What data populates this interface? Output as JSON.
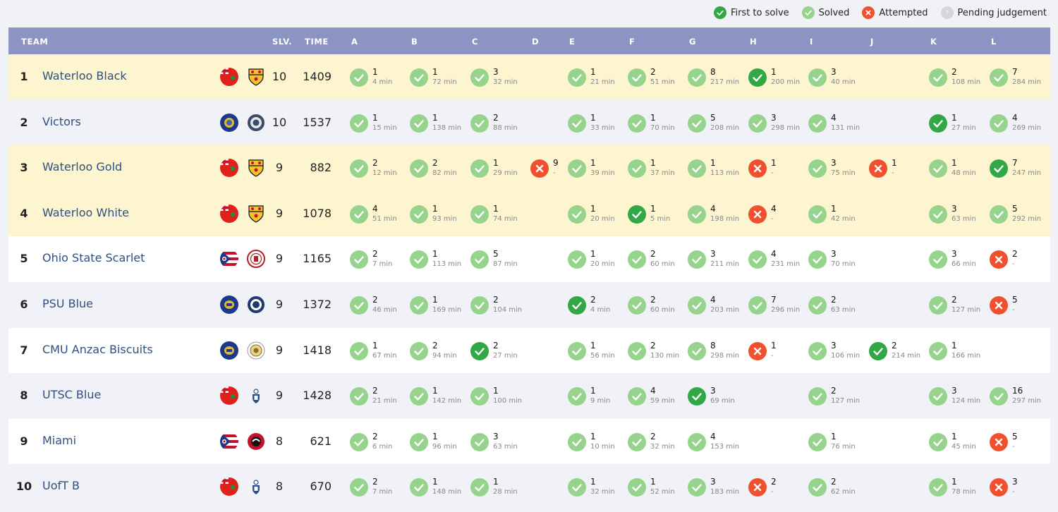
{
  "legend": [
    {
      "label": "First to solve",
      "status": "first"
    },
    {
      "label": "Solved",
      "status": "solved"
    },
    {
      "label": "Attempted",
      "status": "attempted"
    },
    {
      "label": "Pending judgement",
      "status": "pending"
    }
  ],
  "colors": {
    "first": "#31a745",
    "solved": "#96d38c",
    "attempted": "#f1502f",
    "pending": "#d6d6d6",
    "header": "#8c94c3",
    "highlight": "#fcf5cf"
  },
  "header": {
    "team": "TEAM",
    "solved": "SLV.",
    "time": "TIME",
    "problems": [
      "A",
      "B",
      "C",
      "D",
      "E",
      "F",
      "G",
      "H",
      "I",
      "J",
      "K",
      "L"
    ]
  },
  "teams": [
    {
      "rank": "1",
      "name": "Waterloo Black",
      "flag": "ontario-flag",
      "logo": "waterloo-crest-logo",
      "solved": "10",
      "time": "1409",
      "highlight": true,
      "cells": [
        {
          "s": "solved",
          "t": "1",
          "m": "4 min"
        },
        {
          "s": "solved",
          "t": "1",
          "m": "72 min"
        },
        {
          "s": "solved",
          "t": "3",
          "m": "32 min"
        },
        null,
        {
          "s": "solved",
          "t": "1",
          "m": "21 min"
        },
        {
          "s": "solved",
          "t": "2",
          "m": "51 min"
        },
        {
          "s": "solved",
          "t": "8",
          "m": "217 min"
        },
        {
          "s": "first",
          "t": "1",
          "m": "200 min"
        },
        {
          "s": "solved",
          "t": "3",
          "m": "40 min"
        },
        null,
        {
          "s": "solved",
          "t": "2",
          "m": "108 min"
        },
        {
          "s": "solved",
          "t": "7",
          "m": "284 min"
        }
      ]
    },
    {
      "rank": "2",
      "name": "Victors",
      "flag": "michigan-flag",
      "logo": "michigan-seal-logo",
      "solved": "10",
      "time": "1537",
      "highlight": false,
      "cells": [
        {
          "s": "solved",
          "t": "1",
          "m": "15 min"
        },
        {
          "s": "solved",
          "t": "1",
          "m": "138 min"
        },
        {
          "s": "solved",
          "t": "2",
          "m": "88 min"
        },
        null,
        {
          "s": "solved",
          "t": "1",
          "m": "33 min"
        },
        {
          "s": "solved",
          "t": "1",
          "m": "70 min"
        },
        {
          "s": "solved",
          "t": "5",
          "m": "208 min"
        },
        {
          "s": "solved",
          "t": "3",
          "m": "298 min"
        },
        {
          "s": "solved",
          "t": "4",
          "m": "131 min"
        },
        null,
        {
          "s": "first",
          "t": "1",
          "m": "27 min"
        },
        {
          "s": "solved",
          "t": "4",
          "m": "269 min"
        }
      ]
    },
    {
      "rank": "3",
      "name": "Waterloo Gold",
      "flag": "ontario-flag",
      "logo": "waterloo-crest-logo",
      "solved": "9",
      "time": "882",
      "highlight": true,
      "cells": [
        {
          "s": "solved",
          "t": "2",
          "m": "12 min"
        },
        {
          "s": "solved",
          "t": "2",
          "m": "82 min"
        },
        {
          "s": "solved",
          "t": "1",
          "m": "29 min"
        },
        {
          "s": "attempted",
          "t": "9",
          "m": "-"
        },
        {
          "s": "solved",
          "t": "1",
          "m": "39 min"
        },
        {
          "s": "solved",
          "t": "1",
          "m": "37 min"
        },
        {
          "s": "solved",
          "t": "1",
          "m": "113 min"
        },
        {
          "s": "attempted",
          "t": "1",
          "m": "-"
        },
        {
          "s": "solved",
          "t": "3",
          "m": "75 min"
        },
        {
          "s": "attempted",
          "t": "1",
          "m": "-"
        },
        {
          "s": "solved",
          "t": "1",
          "m": "48 min"
        },
        {
          "s": "first",
          "t": "7",
          "m": "247 min"
        }
      ]
    },
    {
      "rank": "4",
      "name": "Waterloo White",
      "flag": "ontario-flag",
      "logo": "waterloo-crest-logo",
      "solved": "9",
      "time": "1078",
      "highlight": true,
      "cells": [
        {
          "s": "solved",
          "t": "4",
          "m": "51 min"
        },
        {
          "s": "solved",
          "t": "1",
          "m": "93 min"
        },
        {
          "s": "solved",
          "t": "1",
          "m": "74 min"
        },
        null,
        {
          "s": "solved",
          "t": "1",
          "m": "20 min"
        },
        {
          "s": "first",
          "t": "1",
          "m": "5 min"
        },
        {
          "s": "solved",
          "t": "4",
          "m": "198 min"
        },
        {
          "s": "attempted",
          "t": "4",
          "m": "-"
        },
        {
          "s": "solved",
          "t": "1",
          "m": "42 min"
        },
        null,
        {
          "s": "solved",
          "t": "3",
          "m": "63 min"
        },
        {
          "s": "solved",
          "t": "5",
          "m": "292 min"
        }
      ]
    },
    {
      "rank": "5",
      "name": "Ohio State Scarlet",
      "flag": "ohio-flag",
      "logo": "ohio-state-seal-logo",
      "solved": "9",
      "time": "1165",
      "highlight": false,
      "cells": [
        {
          "s": "solved",
          "t": "2",
          "m": "7 min"
        },
        {
          "s": "solved",
          "t": "1",
          "m": "113 min"
        },
        {
          "s": "solved",
          "t": "5",
          "m": "87 min"
        },
        null,
        {
          "s": "solved",
          "t": "1",
          "m": "20 min"
        },
        {
          "s": "solved",
          "t": "2",
          "m": "60 min"
        },
        {
          "s": "solved",
          "t": "3",
          "m": "211 min"
        },
        {
          "s": "solved",
          "t": "4",
          "m": "231 min"
        },
        {
          "s": "solved",
          "t": "3",
          "m": "70 min"
        },
        null,
        {
          "s": "solved",
          "t": "3",
          "m": "66 min"
        },
        {
          "s": "attempted",
          "t": "2",
          "m": "-"
        }
      ]
    },
    {
      "rank": "6",
      "name": "PSU Blue",
      "flag": "pennsylvania-flag",
      "logo": "psu-seal-logo",
      "solved": "9",
      "time": "1372",
      "highlight": false,
      "cells": [
        {
          "s": "solved",
          "t": "2",
          "m": "46 min"
        },
        {
          "s": "solved",
          "t": "1",
          "m": "169 min"
        },
        {
          "s": "solved",
          "t": "2",
          "m": "104 min"
        },
        null,
        {
          "s": "first",
          "t": "2",
          "m": "4 min"
        },
        {
          "s": "solved",
          "t": "2",
          "m": "60 min"
        },
        {
          "s": "solved",
          "t": "4",
          "m": "203 min"
        },
        {
          "s": "solved",
          "t": "7",
          "m": "296 min"
        },
        {
          "s": "solved",
          "t": "2",
          "m": "63 min"
        },
        null,
        {
          "s": "solved",
          "t": "2",
          "m": "127 min"
        },
        {
          "s": "attempted",
          "t": "5",
          "m": "-"
        }
      ]
    },
    {
      "rank": "7",
      "name": "CMU Anzac Biscuits",
      "flag": "pennsylvania-flag",
      "logo": "cmu-seal-logo",
      "solved": "9",
      "time": "1418",
      "highlight": false,
      "cells": [
        {
          "s": "solved",
          "t": "1",
          "m": "67 min"
        },
        {
          "s": "solved",
          "t": "2",
          "m": "94 min"
        },
        {
          "s": "first",
          "t": "2",
          "m": "27 min"
        },
        null,
        {
          "s": "solved",
          "t": "1",
          "m": "56 min"
        },
        {
          "s": "solved",
          "t": "2",
          "m": "130 min"
        },
        {
          "s": "solved",
          "t": "8",
          "m": "298 min"
        },
        {
          "s": "attempted",
          "t": "1",
          "m": "-"
        },
        {
          "s": "solved",
          "t": "3",
          "m": "106 min"
        },
        {
          "s": "first",
          "t": "2",
          "m": "214 min"
        },
        {
          "s": "solved",
          "t": "1",
          "m": "166 min"
        },
        null
      ]
    },
    {
      "rank": "8",
      "name": "UTSC Blue",
      "flag": "ontario-flag",
      "logo": "uoft-crest-logo",
      "solved": "9",
      "time": "1428",
      "highlight": false,
      "cells": [
        {
          "s": "solved",
          "t": "2",
          "m": "21 min"
        },
        {
          "s": "solved",
          "t": "1",
          "m": "142 min"
        },
        {
          "s": "solved",
          "t": "1",
          "m": "100 min"
        },
        null,
        {
          "s": "solved",
          "t": "1",
          "m": "9 min"
        },
        {
          "s": "solved",
          "t": "4",
          "m": "59 min"
        },
        {
          "s": "first",
          "t": "3",
          "m": "69 min"
        },
        null,
        {
          "s": "solved",
          "t": "2",
          "m": "127 min"
        },
        null,
        {
          "s": "solved",
          "t": "3",
          "m": "124 min"
        },
        {
          "s": "solved",
          "t": "16",
          "m": "297 min"
        }
      ]
    },
    {
      "rank": "9",
      "name": "Miami",
      "flag": "ohio-flag",
      "logo": "miami-logo",
      "solved": "8",
      "time": "621",
      "highlight": false,
      "cells": [
        {
          "s": "solved",
          "t": "2",
          "m": "6 min"
        },
        {
          "s": "solved",
          "t": "1",
          "m": "96 min"
        },
        {
          "s": "solved",
          "t": "3",
          "m": "63 min"
        },
        null,
        {
          "s": "solved",
          "t": "1",
          "m": "10 min"
        },
        {
          "s": "solved",
          "t": "2",
          "m": "32 min"
        },
        {
          "s": "solved",
          "t": "4",
          "m": "153 min"
        },
        null,
        {
          "s": "solved",
          "t": "1",
          "m": "76 min"
        },
        null,
        {
          "s": "solved",
          "t": "1",
          "m": "45 min"
        },
        {
          "s": "attempted",
          "t": "5",
          "m": "-"
        }
      ]
    },
    {
      "rank": "10",
      "name": "UofT B",
      "flag": "ontario-flag",
      "logo": "uoft-crest-logo",
      "solved": "8",
      "time": "670",
      "highlight": false,
      "cells": [
        {
          "s": "solved",
          "t": "2",
          "m": "7 min"
        },
        {
          "s": "solved",
          "t": "1",
          "m": "148 min"
        },
        {
          "s": "solved",
          "t": "1",
          "m": "28 min"
        },
        null,
        {
          "s": "solved",
          "t": "1",
          "m": "32 min"
        },
        {
          "s": "solved",
          "t": "1",
          "m": "52 min"
        },
        {
          "s": "solved",
          "t": "3",
          "m": "183 min"
        },
        {
          "s": "attempted",
          "t": "2",
          "m": "-"
        },
        {
          "s": "solved",
          "t": "2",
          "m": "62 min"
        },
        null,
        {
          "s": "solved",
          "t": "1",
          "m": "78 min"
        },
        {
          "s": "attempted",
          "t": "3",
          "m": "-"
        }
      ]
    }
  ]
}
